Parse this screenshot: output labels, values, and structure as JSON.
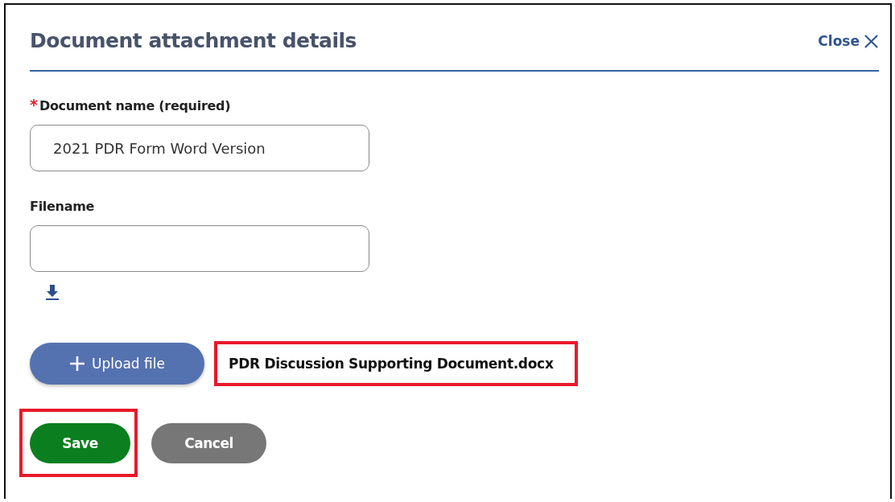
{
  "dialog": {
    "title": "Document attachment details",
    "close_label": "Close"
  },
  "fields": [
    {
      "required_mark": "*",
      "label": "Document name (required)",
      "value": "2021 PDR Form Word Version"
    },
    {
      "label": "Filename"
    }
  ],
  "upload": {
    "label": "Upload file",
    "uploaded_file": "PDR Discussion Supporting Document.docx",
    "highlighted": true
  },
  "buttons": [
    {
      "label": "Save",
      "kind": "primary",
      "highlighted": true
    },
    {
      "label": "Cancel",
      "kind": "secondary",
      "highlighted": false
    }
  ]
}
